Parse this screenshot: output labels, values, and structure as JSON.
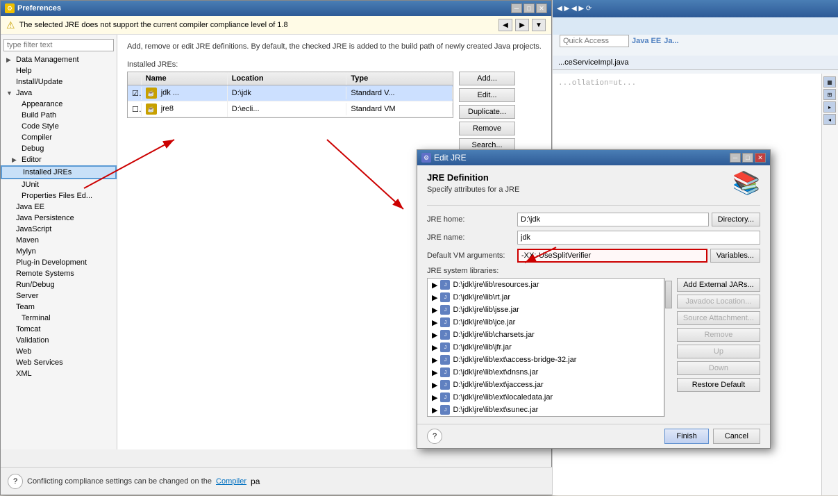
{
  "preferences": {
    "title": "Preferences",
    "filter_placeholder": "type filter text",
    "warning_text": "The selected JRE does not support the current compiler compliance level of 1.8",
    "description": "Add, remove or edit JRE definitions. By default, the checked JRE is added to the build path of newly created Java projects.",
    "installed_jres_label": "Installed JREs:",
    "table_headers": [
      "Name",
      "Location",
      "Type"
    ],
    "jre_rows": [
      {
        "checked": true,
        "name": "jdk ...",
        "location": "D:\\jdk",
        "type": "Standard V...",
        "selected": true
      },
      {
        "checked": false,
        "name": "jre8",
        "location": "D:\\ecli...",
        "type": "Standard VM",
        "selected": false
      }
    ],
    "buttons": {
      "add": "Add...",
      "edit": "Edit...",
      "duplicate": "Duplicate...",
      "remove": "Remove",
      "search": "Search..."
    },
    "conflict_text": "Conflicting compliance settings can be changed on the",
    "compiler_link": "Compiler",
    "page_text": "pa",
    "help_btn": "?"
  },
  "sidebar": {
    "filter_placeholder": "type filter text",
    "items": [
      {
        "label": "Data Management",
        "level": 0,
        "expandable": true,
        "expanded": false
      },
      {
        "label": "Help",
        "level": 0,
        "expandable": false
      },
      {
        "label": "Install/Update",
        "level": 0,
        "expandable": false
      },
      {
        "label": "Java",
        "level": 0,
        "expandable": true,
        "expanded": true
      },
      {
        "label": "Appearance",
        "level": 1,
        "expandable": false
      },
      {
        "label": "Build Path",
        "level": 1,
        "expandable": false
      },
      {
        "label": "Code Style",
        "level": 1,
        "expandable": false
      },
      {
        "label": "Compiler",
        "level": 1,
        "expandable": false
      },
      {
        "label": "Debug",
        "level": 1,
        "expandable": false
      },
      {
        "label": "Editor",
        "level": 1,
        "expandable": true,
        "expanded": false
      },
      {
        "label": "Installed JREs",
        "level": 1,
        "expandable": false,
        "selected": true
      },
      {
        "label": "JUnit",
        "level": 1,
        "expandable": false
      },
      {
        "label": "Properties Files Ed...",
        "level": 1,
        "expandable": false
      },
      {
        "label": "Java EE",
        "level": 0,
        "expandable": false
      },
      {
        "label": "Java Persistence",
        "level": 0,
        "expandable": false
      },
      {
        "label": "JavaScript",
        "level": 0,
        "expandable": false
      },
      {
        "label": "Maven",
        "level": 0,
        "expandable": false
      },
      {
        "label": "Mylyn",
        "level": 0,
        "expandable": false
      },
      {
        "label": "Plug-in Development",
        "level": 0,
        "expandable": false
      },
      {
        "label": "Remote Systems",
        "level": 0,
        "expandable": false
      },
      {
        "label": "Run/Debug",
        "level": 0,
        "expandable": false
      },
      {
        "label": "Server",
        "level": 0,
        "expandable": false
      },
      {
        "label": "Team",
        "level": 0,
        "expandable": false
      },
      {
        "label": "Terminal",
        "level": 1,
        "expandable": false
      },
      {
        "label": "Tomcat",
        "level": 0,
        "expandable": false
      },
      {
        "label": "Validation",
        "level": 0,
        "expandable": false
      },
      {
        "label": "Web",
        "level": 0,
        "expandable": false
      },
      {
        "label": "Web Services",
        "level": 0,
        "expandable": false
      },
      {
        "label": "XML",
        "level": 0,
        "expandable": false
      }
    ]
  },
  "edit_jre": {
    "title": "Edit JRE",
    "section_title": "JRE Definition",
    "section_sub": "Specify attributes for a JRE",
    "jre_home_label": "JRE home:",
    "jre_home_value": "D:\\jdk",
    "directory_btn": "Directory...",
    "jre_name_label": "JRE name:",
    "jre_name_value": "jdk",
    "default_vm_label": "Default VM arguments:",
    "default_vm_value": "-XX:-UseSplitVerifier",
    "jre_libs_label": "JRE system libraries:",
    "libraries": [
      "D:\\jdk\\jre\\lib\\resources.jar",
      "D:\\jdk\\jre\\lib\\rt.jar",
      "D:\\jdk\\jre\\lib\\jsse.jar",
      "D:\\jdk\\jre\\lib\\jce.jar",
      "D:\\jdk\\jre\\lib\\charsets.jar",
      "D:\\jdk\\jre\\lib\\jfr.jar",
      "D:\\jdk\\jre\\lib\\ext\\access-bridge-32.jar",
      "D:\\jdk\\jre\\lib\\ext\\dnsns.jar",
      "D:\\jdk\\jre\\lib\\ext\\jaccess.jar",
      "D:\\jdk\\jre\\lib\\ext\\localedata.jar",
      "D:\\jdk\\jre\\lib\\ext\\sunec.jar"
    ],
    "buttons": {
      "add_external": "Add External JARs...",
      "javadoc_location": "Javadoc Location...",
      "source_attachment": "Source Attachment...",
      "remove": "Remove",
      "up": "Up",
      "down": "Down",
      "restore_default": "Restore Default"
    },
    "finish_btn": "Finish",
    "cancel_btn": "Cancel",
    "help_btn": "?"
  },
  "eclipse_topbar": {
    "quick_access_placeholder": "Quick Access"
  }
}
